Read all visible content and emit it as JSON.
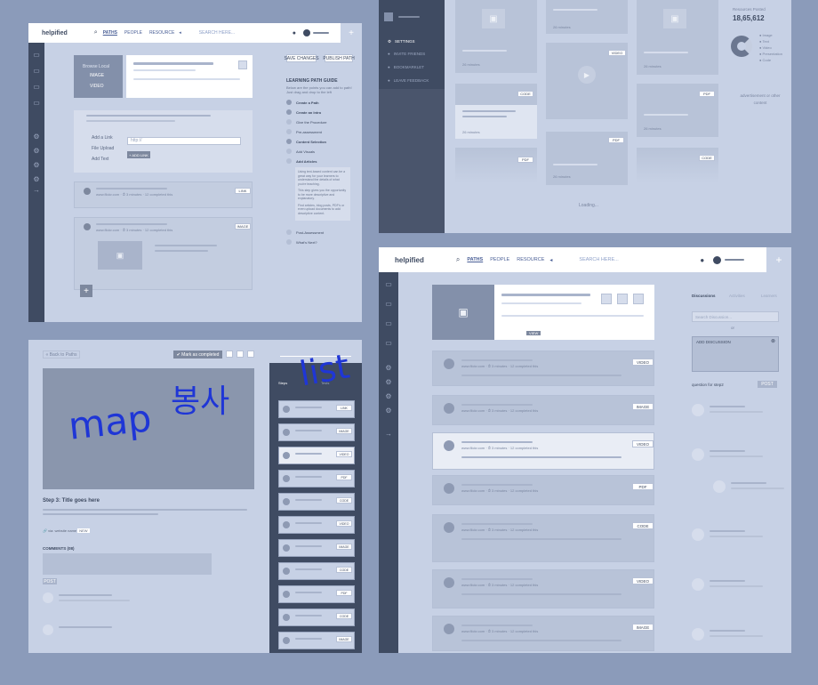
{
  "app": {
    "logo": "helpified",
    "nav": [
      "PATHS",
      "PEOPLE",
      "RESOURCE"
    ],
    "search_placeholder": "SEARCH HERE..."
  },
  "editor": {
    "browse_local": "Browse Local",
    "browse_items": [
      "IMAGE",
      "VIDEO"
    ],
    "save_changes": "SAVE CHANGES",
    "publish": "PUBLISH PATH",
    "add_link": "Add a Link",
    "file_upload": "File Upload",
    "add_text": "Add Text",
    "url_placeholder": "http://",
    "add_link_btn": "+ ADD LINK",
    "guide_title": "LEARNING PATH GUIDE",
    "guide_desc": "Below are the points you can add to path! Just drag and drop to the left",
    "guide_items": [
      "Create a Path",
      "Create an Intro",
      "Give the Procedure",
      "Pre-assessment",
      "Content Selection",
      "Add Visuals",
      "Add Articles",
      "Post-Assessment",
      "What's Next?"
    ],
    "guide_note": [
      "Using text-based content can be a great way for your learners to understand the details of what you're teaching.",
      "This step gives you the opportunity to be more descriptive and explanatory.",
      "Find articles, blog posts, PDF's or even upload documents to add descriptive content."
    ],
    "source_meta": "www.flickr.com  ·  ⏱ 3 minutes  ·  12 completed this",
    "link_label": "LINK",
    "image_label": "IMAGE"
  },
  "browse": {
    "menu": [
      "SETTINGS",
      "INVITE FRIENDS",
      "BOOKMARKLET",
      "LEAVE FEEDBACK"
    ],
    "tile_meta": "26 minutes",
    "labels": [
      "VIDEO",
      "CODE",
      "PDF",
      "PDF",
      "PDF",
      "CODE"
    ],
    "resources_label": "Resources Posted",
    "resources_count": "18,65,612",
    "legend": [
      "Image",
      "Text",
      "Video",
      "Presentation",
      "Code"
    ],
    "ad": "advertisement or other content",
    "loading": "Loading..."
  },
  "step": {
    "back": "« Back to Paths",
    "mark_complete": "✔ Mark as completed",
    "title": "Step 3: Title goes here",
    "website": "via: website name",
    "website_tag": "NEW",
    "comments": "COMMENTS (08)",
    "post": "POST",
    "steps_tab": [
      "Steps",
      "",
      "Tests"
    ],
    "step_labels": [
      "LINK",
      "IMAGE",
      "VIDEO",
      "PDF",
      "CODE",
      "VIDEO",
      "IMAGE",
      "CODE",
      "PDF",
      "CODE",
      "IMAGE"
    ],
    "scribble_1": "map",
    "scribble_2": "봉사",
    "scribble_3": "list"
  },
  "path": {
    "tag": "VIEW",
    "row_meta": "www.flickr.com  ·  ⏱ 3 minutes  ·  12 completed this",
    "row_labels": [
      "VIDEO",
      "IMAGE",
      "VIDEO",
      "PDF",
      "CODE",
      "VIDEO",
      "IMAGE"
    ],
    "side_tabs": [
      "Discussions",
      "Activities",
      "Learners"
    ],
    "search_discussion": "Search Discussion...",
    "or": "or",
    "add_discussion": "ADD DISCUSSION",
    "question_for": "question for step2",
    "post": "POST"
  }
}
